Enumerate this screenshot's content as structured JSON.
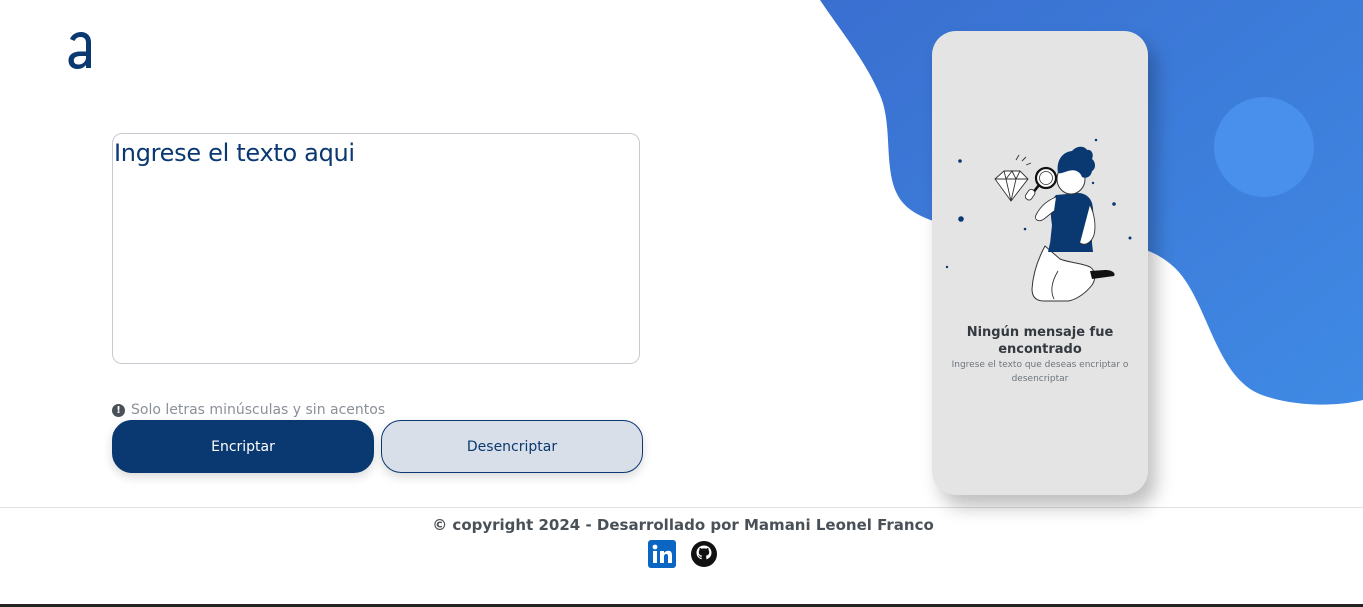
{
  "brand": {
    "logo_icon": "alura-a-logo-icon"
  },
  "input": {
    "placeholder": "Ingrese el texto aqui"
  },
  "hint": {
    "icon": "exclamation-circle-icon",
    "text": "Solo letras minúsculas y sin acentos"
  },
  "actions": {
    "encrypt_label": "Encriptar",
    "decrypt_label": "Desencriptar"
  },
  "output_panel": {
    "illustration": "person-with-magnifier-illustration",
    "title": "Ningún mensaje fue encontrado",
    "subtitle": "Ingrese el texto que deseas encriptar o desencriptar"
  },
  "footer": {
    "copyright": "© copyright 2024 - Desarrollado por Mamani Leonel Franco",
    "social": [
      {
        "name": "linkedin-icon"
      },
      {
        "name": "github-icon"
      }
    ]
  },
  "colors": {
    "primary": "#0a3871",
    "secondary_bg": "#d8dfe8",
    "panel_bg": "#e4e4e4",
    "blob_blue": "#3b7ddc"
  }
}
